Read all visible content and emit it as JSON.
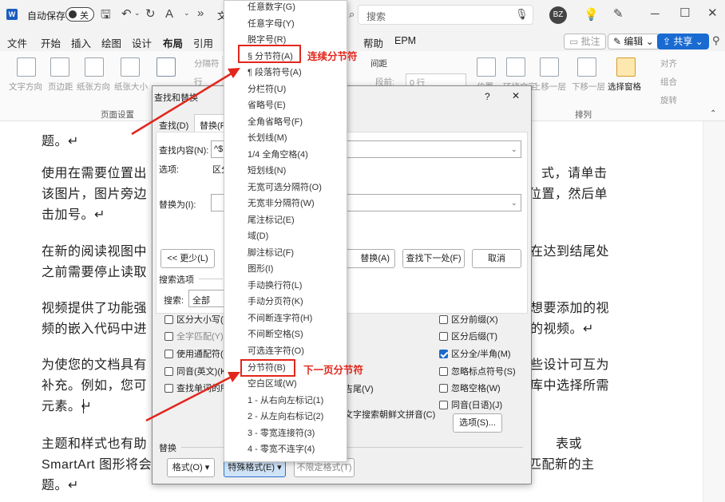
{
  "titlebar": {
    "autosave": "自动保存",
    "autosave_state": "关",
    "char_hint": "文",
    "search_placeholder": "搜索",
    "avatar": "BZ"
  },
  "menubar": {
    "items": [
      "文件",
      "开始",
      "插入",
      "绘图",
      "设计",
      "布局",
      "引用",
      "帮助",
      "EPM"
    ],
    "active": "布局",
    "comment": "批注",
    "edit": "编辑",
    "share": "共享"
  },
  "ribbon": {
    "page_setup": {
      "buttons": [
        "文字方向",
        "页边距",
        "纸张方向",
        "纸张大小"
      ],
      "label": "页面设置",
      "columns_fragment": "分隔符",
      "row_fragment": "行"
    },
    "paragraph": {
      "spacing": "间距",
      "before_label": "段前:",
      "before_value": "0 行"
    },
    "arrange": {
      "buttons": [
        "位置",
        "环绕文字",
        "上移一层",
        "下移一层",
        "选择窗格"
      ],
      "align": "对齐",
      "group": "组合",
      "rotate": "旋转",
      "label": "排列"
    }
  },
  "document": {
    "paragraphs": [
      [
        "题。↵"
      ],
      [
        "使用在需要位置出",
        "式，请单击",
        "该图片，图片旁边",
        "位置，然后单",
        "击加号。↵"
      ],
      [
        "在新的阅读视图中",
        "在达到结尾处",
        "之前需要停止读取"
      ],
      [
        "视频提供了功能强",
        "想要添加的视",
        "频的嵌入代码中进",
        "的视频。↵"
      ],
      [
        "为使您的文档具有",
        "些设计可互为",
        "补充。例如，您可",
        "库中选择所需",
        "元素。↵"
      ],
      [
        "主题和样式也有助",
        "表或",
        "SmartArt 图形将会",
        "匹配新的主",
        "题。↵"
      ]
    ]
  },
  "dialog": {
    "title": "查找和替换",
    "help": "?",
    "close": "✕",
    "tabs": [
      "查找(D)",
      "替换(P"
    ],
    "find_label": "查找内容(N):",
    "find_value": "^$",
    "options_label": "选项:",
    "options_value": "区分",
    "replace_label": "替换为(I):",
    "less_button": "<< 更少(L)",
    "replace_button": "替换(A)",
    "find_next_button": "查找下一处(F)",
    "cancel_button": "取消",
    "search_options_title": "搜索选项",
    "search_label": "搜索:",
    "search_value": "全部",
    "left_checks": [
      "区分大小写(",
      "全字匹配(Y)",
      "使用通配符(",
      "同音(英文)(K",
      "查找单词的所"
    ],
    "right_checks": [
      "区分前缀(X)",
      "区分后缀(T)",
      "区分全/半角(M)",
      "忽略标点符号(S)",
      "忽略空格(W)",
      "同音(日语)(J)"
    ],
    "mid_fragment_1": "吉尾(V)",
    "mid_fragment_2": "文字搜索朝鲜文拼音(C)",
    "options_button": "选项(S)...",
    "replace_section": "替换",
    "format_button": "格式(O)",
    "special_button": "特殊格式(E)",
    "no_format_button": "不限定格式(T)"
  },
  "special_menu": {
    "items": [
      "任意数字(G)",
      "任意字母(Y)",
      "脱字号(R)",
      "§ 分节符(A)",
      "¶ 段落符号(A)",
      "分栏符(U)",
      "省略号(E)",
      "全角省略号(F)",
      "长划线(M)",
      "1/4 全角空格(4)",
      "短划线(N)",
      "无宽可选分隔符(O)",
      "无宽非分隔符(W)",
      "尾注标记(E)",
      "域(D)",
      "脚注标记(F)",
      "图形(I)",
      "手动换行符(L)",
      "手动分页符(K)",
      "不间断连字符(H)",
      "不间断空格(S)",
      "可选连字符(O)",
      "分节符(B)",
      "空白区域(W)",
      "1 - 从右向左标记(1)",
      "2 - 从左向右标记(2)",
      "3 - 零宽连接符(3)",
      "4 - 零宽不连字(4)"
    ]
  },
  "annotations": {
    "top": "连续分节符",
    "bottom": "下一页分节符",
    "color": "#e2261c"
  }
}
